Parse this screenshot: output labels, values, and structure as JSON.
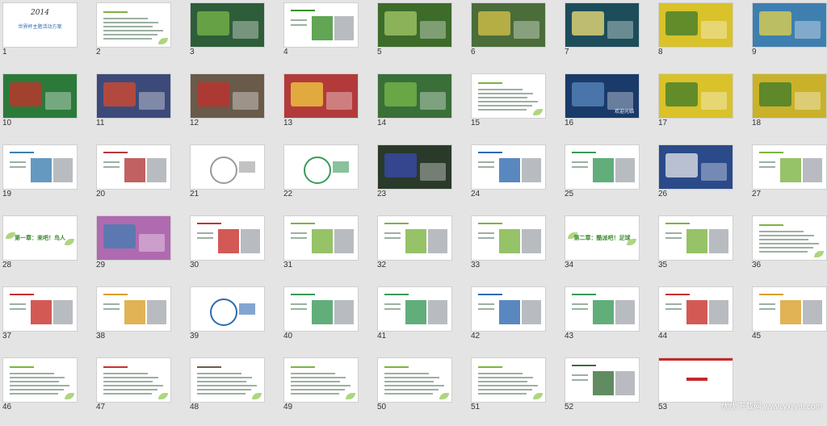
{
  "watermark": "优优下载网 www.yxrym.com",
  "slides": [
    {
      "n": "1",
      "kind": "title",
      "bg": "#ffffff",
      "text": "2014",
      "sub": "世界杯主题活动方案"
    },
    {
      "n": "2",
      "kind": "text",
      "bg": "#ffffff"
    },
    {
      "n": "3",
      "kind": "photo",
      "bg": "#2e5d3a",
      "accent": "#7ab84a"
    },
    {
      "n": "4",
      "kind": "figure",
      "bg": "#ffffff",
      "accent": "#3a8f2b"
    },
    {
      "n": "5",
      "kind": "photo",
      "bg": "#3d6b2a",
      "accent": "#a5c96a"
    },
    {
      "n": "6",
      "kind": "photo",
      "bg": "#4a6d3a",
      "accent": "#d8c44a"
    },
    {
      "n": "7",
      "kind": "photo",
      "bg": "#1d4d5a",
      "accent": "#f4e27a"
    },
    {
      "n": "8",
      "kind": "photo",
      "bg": "#d9c22a",
      "accent": "#3a7a2b"
    },
    {
      "n": "9",
      "kind": "photo",
      "bg": "#3f7fb0",
      "accent": "#e6d34a"
    },
    {
      "n": "10",
      "kind": "photo",
      "bg": "#2b7a3a",
      "accent": "#c8302b"
    },
    {
      "n": "11",
      "kind": "photo",
      "bg": "#3c4a7a",
      "accent": "#d94a2b"
    },
    {
      "n": "12",
      "kind": "photo",
      "bg": "#6a5a4a",
      "accent": "#c3302b"
    },
    {
      "n": "13",
      "kind": "photo",
      "bg": "#b33a3a",
      "accent": "#f0d040"
    },
    {
      "n": "14",
      "kind": "photo",
      "bg": "#3a6f3a",
      "accent": "#7ab84a"
    },
    {
      "n": "15",
      "kind": "text",
      "bg": "#ffffff"
    },
    {
      "n": "16",
      "kind": "photo",
      "bg": "#1a3a6a",
      "accent": "#5a8ac0",
      "label": "欢迎光临"
    },
    {
      "n": "17",
      "kind": "photo",
      "bg": "#d9c22a",
      "accent": "#3a7a2b"
    },
    {
      "n": "18",
      "kind": "photo",
      "bg": "#c9b22a",
      "accent": "#3a7a2b"
    },
    {
      "n": "19",
      "kind": "figure",
      "bg": "#ffffff",
      "accent": "#3f7fb0"
    },
    {
      "n": "20",
      "kind": "figure",
      "bg": "#ffffff",
      "accent": "#b33a3a"
    },
    {
      "n": "21",
      "kind": "diagram",
      "bg": "#ffffff",
      "accent": "#999999"
    },
    {
      "n": "22",
      "kind": "diagram",
      "bg": "#ffffff",
      "accent": "#3a9a5a"
    },
    {
      "n": "23",
      "kind": "photo",
      "bg": "#2a3a2a",
      "accent": "#3a4ab0"
    },
    {
      "n": "24",
      "kind": "figure",
      "bg": "#ffffff",
      "accent": "#2f6ab0"
    },
    {
      "n": "25",
      "kind": "figure",
      "bg": "#ffffff",
      "accent": "#3a9a5a"
    },
    {
      "n": "26",
      "kind": "photo",
      "bg": "#2a4a8a",
      "accent": "#e8e8e8"
    },
    {
      "n": "27",
      "kind": "figure",
      "bg": "#ffffff",
      "accent": "#7cb342"
    },
    {
      "n": "28",
      "kind": "chapter",
      "bg": "#ffffff",
      "text": "第一章：来吧！鸟人"
    },
    {
      "n": "29",
      "kind": "photo",
      "bg": "#b06ab0",
      "accent": "#3f7fb0"
    },
    {
      "n": "30",
      "kind": "figure",
      "bg": "#ffffff",
      "accent": "#c8302b"
    },
    {
      "n": "31",
      "kind": "figure",
      "bg": "#ffffff",
      "accent": "#7cb342"
    },
    {
      "n": "32",
      "kind": "figure",
      "bg": "#ffffff",
      "accent": "#7cb342"
    },
    {
      "n": "33",
      "kind": "figure",
      "bg": "#ffffff",
      "accent": "#7cb342"
    },
    {
      "n": "34",
      "kind": "chapter",
      "bg": "#ffffff",
      "text": "第二章：酷派吧！足球"
    },
    {
      "n": "35",
      "kind": "figure",
      "bg": "#ffffff",
      "accent": "#7cb342"
    },
    {
      "n": "36",
      "kind": "text",
      "bg": "#ffffff"
    },
    {
      "n": "37",
      "kind": "figure",
      "bg": "#ffffff",
      "accent": "#c8302b"
    },
    {
      "n": "38",
      "kind": "figure",
      "bg": "#ffffff",
      "accent": "#d9a02a"
    },
    {
      "n": "39",
      "kind": "diagram",
      "bg": "#ffffff",
      "accent": "#2f6ab0"
    },
    {
      "n": "40",
      "kind": "figure",
      "bg": "#ffffff",
      "accent": "#3a9a5a"
    },
    {
      "n": "41",
      "kind": "figure",
      "bg": "#ffffff",
      "accent": "#3a9a5a"
    },
    {
      "n": "42",
      "kind": "figure",
      "bg": "#ffffff",
      "accent": "#2f6ab0"
    },
    {
      "n": "43",
      "kind": "figure",
      "bg": "#ffffff",
      "accent": "#3a9a5a"
    },
    {
      "n": "44",
      "kind": "figure",
      "bg": "#ffffff",
      "accent": "#c8302b"
    },
    {
      "n": "45",
      "kind": "figure",
      "bg": "#ffffff",
      "accent": "#d9a02a"
    },
    {
      "n": "46",
      "kind": "text",
      "bg": "#ffffff"
    },
    {
      "n": "47",
      "kind": "text",
      "bg": "#ffffff",
      "accent": "#c8302b"
    },
    {
      "n": "48",
      "kind": "text",
      "bg": "#ffffff",
      "accent": "#6a5a4a"
    },
    {
      "n": "49",
      "kind": "text",
      "bg": "#ffffff"
    },
    {
      "n": "50",
      "kind": "text",
      "bg": "#ffffff"
    },
    {
      "n": "51",
      "kind": "text",
      "bg": "#ffffff"
    },
    {
      "n": "52",
      "kind": "figure",
      "bg": "#ffffff",
      "accent": "#3a6f3a"
    },
    {
      "n": "53",
      "kind": "end",
      "bg": "#ffffff",
      "accent": "#c62828"
    }
  ]
}
